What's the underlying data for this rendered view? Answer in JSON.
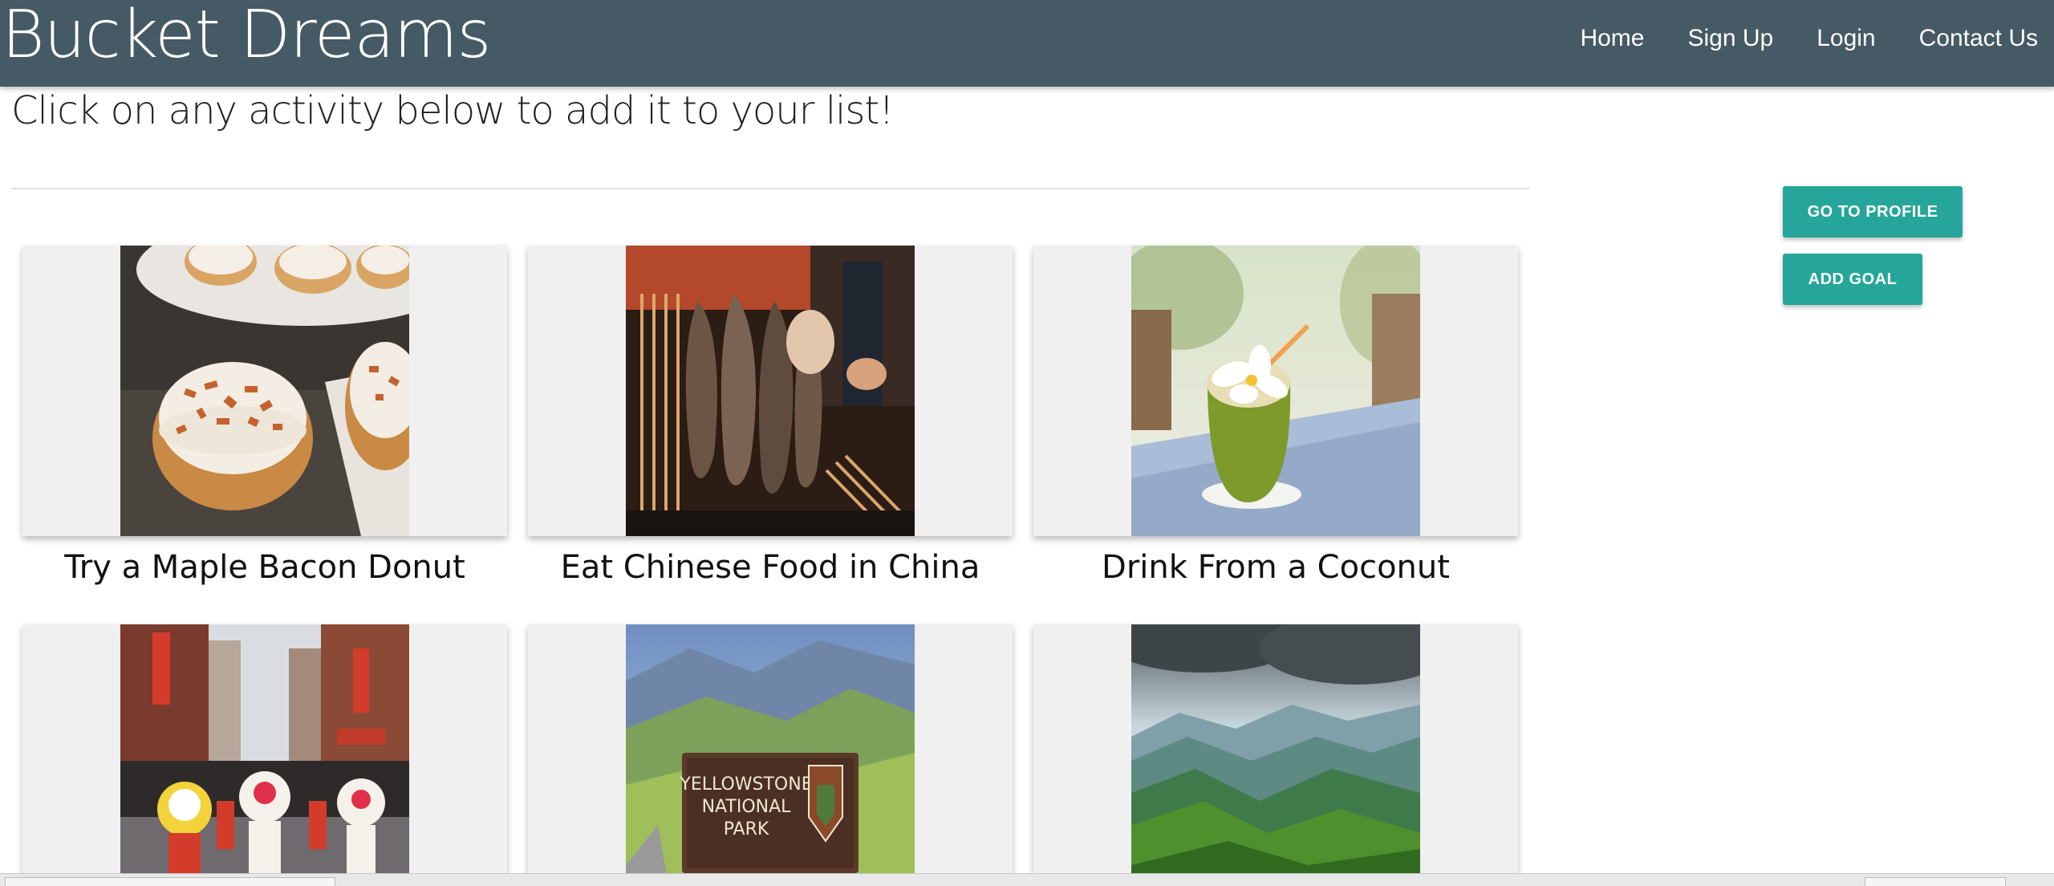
{
  "header": {
    "brand": "Bucket Dreams",
    "nav": [
      "Home",
      "Sign Up",
      "Login",
      "Contact Us"
    ]
  },
  "intro": "Click on any activity below to add it to your list!",
  "actions": {
    "profile": "GO TO PROFILE",
    "add_goal": "ADD GOAL"
  },
  "activities": [
    {
      "title": "Try a Maple Bacon Donut"
    },
    {
      "title": "Eat Chinese Food in China"
    },
    {
      "title": "Drink From a Coconut"
    },
    {
      "title": ""
    },
    {
      "title": ""
    },
    {
      "title": ""
    }
  ],
  "signs": {
    "yellowstone": [
      "YELLOWSTONE",
      "NATIONAL",
      "PARK"
    ]
  },
  "colors": {
    "navbar": "#455a64",
    "accent": "#26a69a",
    "card_bg": "#f0f0f0"
  }
}
